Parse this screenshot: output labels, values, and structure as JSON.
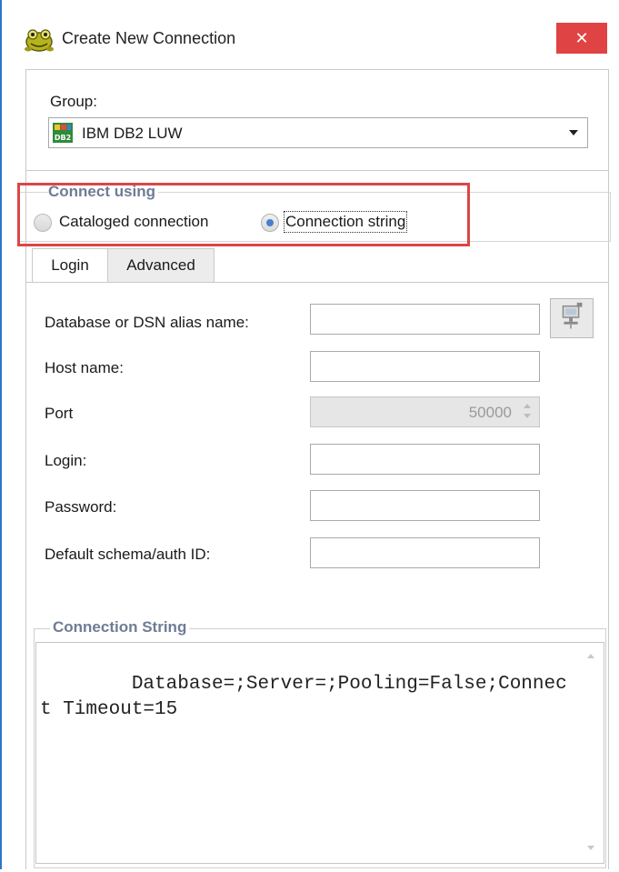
{
  "window": {
    "title": "Create New Connection",
    "close_glyph": "✕",
    "app_icon": "toad-frog-icon"
  },
  "group": {
    "label": "Group:",
    "value": "IBM DB2 LUW",
    "icon": "db2-icon",
    "icon_text": "DB2"
  },
  "connect_using": {
    "legend": "Connect using",
    "options": [
      {
        "label": "Cataloged connection",
        "selected": false
      },
      {
        "label": "Connection string",
        "selected": true
      }
    ]
  },
  "tabs": [
    {
      "label": "Login",
      "active": true
    },
    {
      "label": "Advanced",
      "active": false
    }
  ],
  "fields": {
    "database_alias": {
      "label": "Database or DSN alias name:",
      "value": ""
    },
    "host_name": {
      "label": "Host name:",
      "value": ""
    },
    "port": {
      "label": "Port",
      "value": "50000",
      "enabled": false
    },
    "login": {
      "label": "Login:",
      "value": ""
    },
    "password": {
      "label": "Password:",
      "value": ""
    },
    "default_schema": {
      "label": "Default schema/auth ID:",
      "value": ""
    }
  },
  "connection_string": {
    "legend": "Connection String",
    "value": "Database=;Server=;Pooling=False;Connect Timeout=15"
  },
  "colors": {
    "close_button": "#e04343",
    "highlight_frame": "#dc4646",
    "legend_text": "#6f7c95",
    "window_border": "#2b78c6"
  }
}
